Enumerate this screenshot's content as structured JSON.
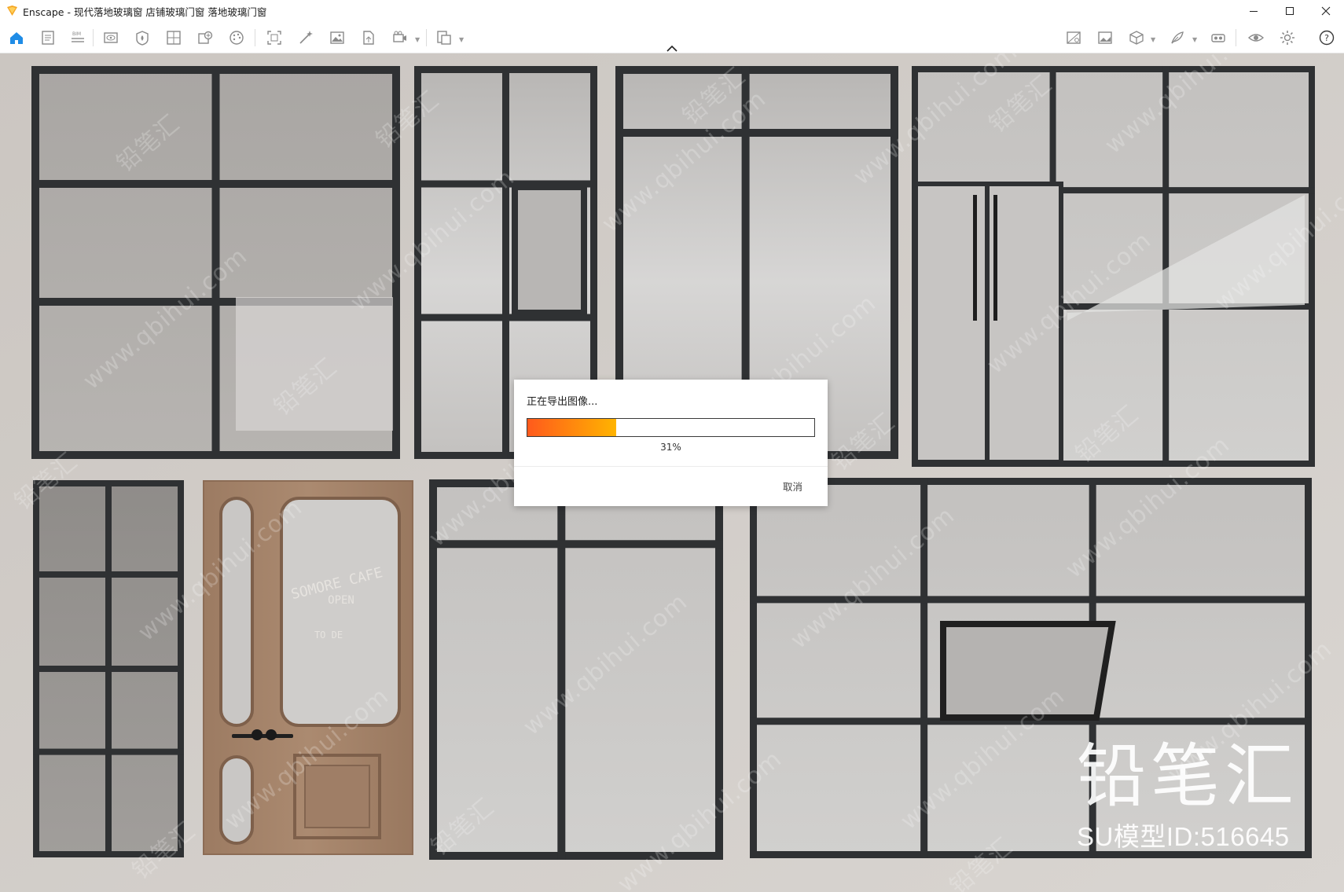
{
  "window": {
    "app_name": "Enscape",
    "title": "Enscape - 现代落地玻璃窗 店铺玻璃门窗 落地玻璃门窗"
  },
  "toolbar": {
    "left_icons": [
      "home-icon",
      "document-icon",
      "bim-icon",
      "eye-view-icon",
      "material-icon",
      "grid-icon",
      "asset-add-icon",
      "palette-icon",
      "frame-icon",
      "magic-wand-icon",
      "image-icon",
      "file-export-icon",
      "video-icon",
      "batch-render-icon"
    ],
    "right_icons": [
      "image-settings-icon",
      "gallery-icon",
      "cube-icon",
      "feather-icon",
      "vr-headset-icon",
      "visibility-icon",
      "settings-icon",
      "help-icon"
    ]
  },
  "scene": {
    "brand_name": "铅笔汇",
    "model_id": "SU模型ID:516645",
    "door_sign": [
      "SOMORE CAFE",
      "OPEN",
      "TO DE"
    ],
    "watermark_text": "www.qbihui.com",
    "watermark_logo": "铅笔汇"
  },
  "dialog": {
    "title": "正在导出图像...",
    "progress": 0.31,
    "progress_label": "31%",
    "cancel_label": "取消"
  },
  "colors": {
    "progress_start": "#ff5a1c",
    "progress_end": "#ffb400",
    "accent": "#1f8ce6",
    "frame": "#2f3133",
    "wall": "#d3cfcb",
    "wood": "#a4836a"
  }
}
